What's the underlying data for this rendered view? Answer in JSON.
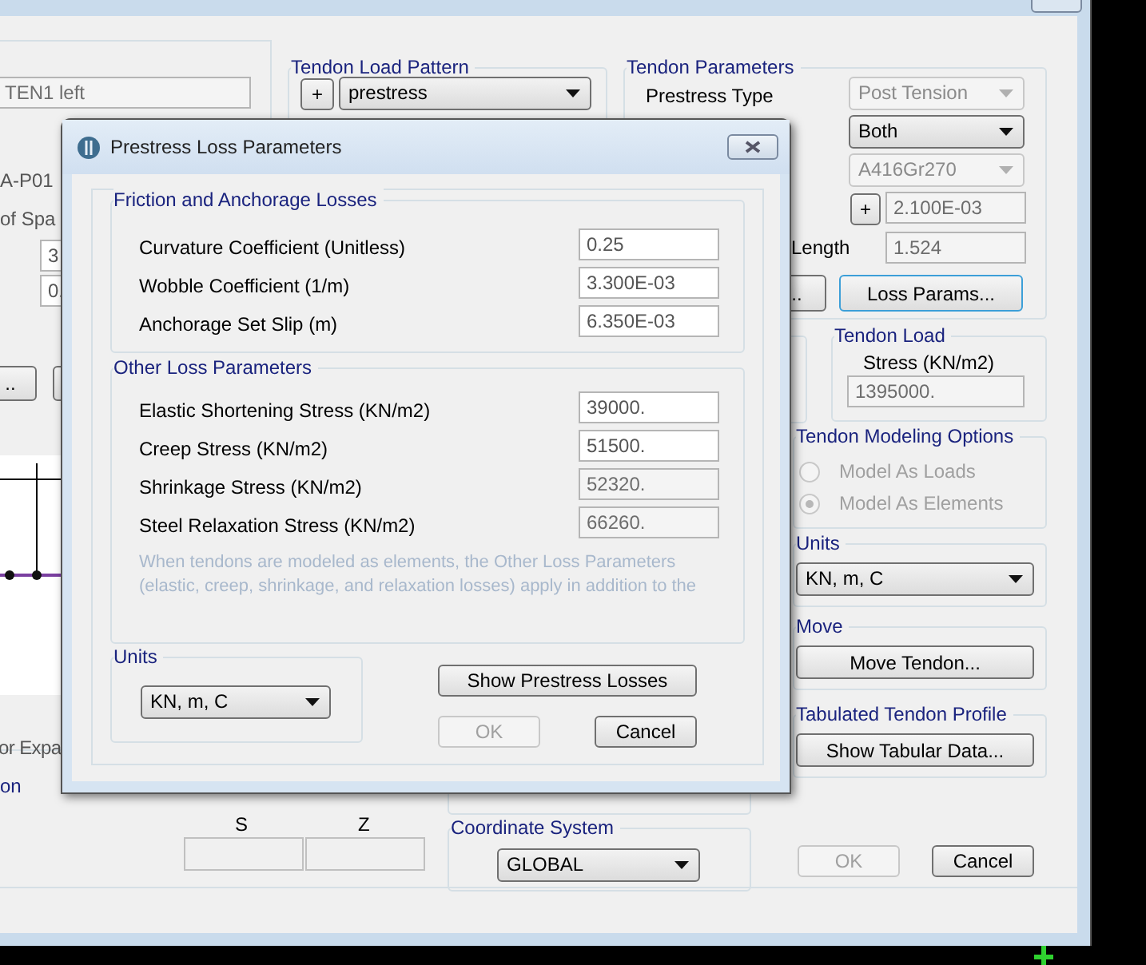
{
  "background_window": {
    "left": {
      "name_field": "TEN1 left",
      "label_1": "A-P01",
      "label_2": "of Spa",
      "field_1": "3",
      "field_2": "0.",
      "button_text": "..",
      "label_3": "or Expa",
      "label_4": "on"
    },
    "columns": [
      "S",
      "Z"
    ],
    "tendon_load_pattern": {
      "title": "Tendon Load Pattern",
      "add": "+",
      "value": "prestress"
    },
    "coordinate_system": {
      "title": "Coordinate System",
      "value": "GLOBAL"
    },
    "tendon_parameters": {
      "title": "Tendon Parameters",
      "prestress_type_label": "Prestress Type",
      "combos": [
        {
          "value": "Post Tension",
          "disabled": true
        },
        {
          "value": "Both",
          "disabled": false
        },
        {
          "value": "A416Gr270",
          "disabled": true
        }
      ],
      "add": "+",
      "area": {
        "value": "2.100E-03",
        "disabled": true
      },
      "length_label": "Length",
      "length": {
        "value": "1.524",
        "disabled": true
      },
      "partial_button": "..",
      "loss_params": "Loss Params..."
    },
    "tendon_load": {
      "title": "Tendon Load",
      "stress_label": "Stress  (KN/m2)",
      "stress": {
        "value": "1395000.",
        "disabled": true
      }
    },
    "modeling_options": {
      "title": "Tendon Modeling Options",
      "options": [
        {
          "label": "Model As Loads",
          "selected": false,
          "disabled": true
        },
        {
          "label": "Model As Elements",
          "selected": true,
          "disabled": true
        }
      ]
    },
    "units": {
      "title": "Units",
      "value": "KN, m, C"
    },
    "move": {
      "title": "Move",
      "button": "Move Tendon..."
    },
    "tabulated": {
      "title": "Tabulated Tendon Profile",
      "button": "Show Tabular Data..."
    },
    "buttons": [
      {
        "label": "OK",
        "disabled": true
      },
      {
        "label": "Cancel",
        "disabled": false
      }
    ]
  },
  "dialog": {
    "title": "Prestress Loss Parameters",
    "friction": {
      "title": "Friction and Anchorage Losses",
      "rows": [
        {
          "label": "Curvature Coefficient  (Unitless)",
          "value": "0.25",
          "disabled": false
        },
        {
          "label": "Wobble Coefficient  (1/m)",
          "value": "3.300E-03",
          "disabled": false
        },
        {
          "label": "Anchorage Set Slip  (m)",
          "value": "6.350E-03",
          "disabled": false
        }
      ]
    },
    "other": {
      "title": "Other Loss Parameters",
      "rows": [
        {
          "label": "Elastic Shortening Stress  (KN/m2)",
          "value": "39000.",
          "disabled": false
        },
        {
          "label": "Creep Stress  (KN/m2)",
          "value": "51500.",
          "disabled": false
        },
        {
          "label": "Shrinkage Stress  (KN/m2)",
          "value": "52320.",
          "disabled": true
        },
        {
          "label": "Steel Relaxation Stress  (KN/m2)",
          "value": "66260.",
          "disabled": true
        }
      ],
      "note_lines": [
        "When tendons are modeled as elements, the Other Loss Parameters",
        "(elastic, creep, shrinkage, and relaxation losses) apply in addition to the"
      ]
    },
    "units": {
      "title": "Units",
      "value": "KN, m, C"
    },
    "show_losses": "Show Prestress Losses",
    "buttons": [
      {
        "label": "OK",
        "disabled": true
      },
      {
        "label": "Cancel",
        "disabled": false
      }
    ]
  }
}
